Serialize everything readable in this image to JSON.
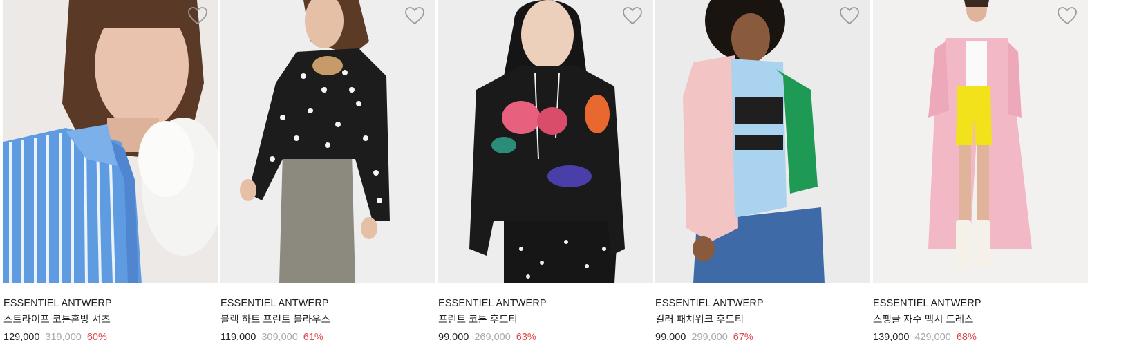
{
  "products": [
    {
      "brand": "ESSENTIEL ANTWERP",
      "name": "스트라이프 코튼혼방 셔츠",
      "price": "129,000",
      "original_price": "319,000",
      "discount": "60%",
      "image_icon": "model-striped-shirt-image",
      "colors": {
        "bg": "#ece9e7",
        "garment": "#5f9be0",
        "accent": "#f4f4f2",
        "hair": "#5a3a26",
        "skin": "#e9c3ae"
      }
    },
    {
      "brand": "ESSENTIEL ANTWERP",
      "name": "블랙 하트 프린트 블라우스",
      "price": "119,000",
      "original_price": "309,000",
      "discount": "61%",
      "image_icon": "model-heart-blouse-image",
      "colors": {
        "bg": "#eeeeee",
        "garment": "#1c1c1c",
        "accent": "#8c8a7e",
        "hair": "#5b3a26",
        "skin": "#e5bfa6"
      }
    },
    {
      "brand": "ESSENTIEL ANTWERP",
      "name": "프린트 코튼 후드티",
      "price": "99,000",
      "original_price": "269,000",
      "discount": "63%",
      "image_icon": "model-print-hoodie-image",
      "colors": {
        "bg": "#ededed",
        "garment": "#1a1a1a",
        "accent": "#e7617f",
        "hair": "#151515",
        "skin": "#ecd0bc"
      }
    },
    {
      "brand": "ESSENTIEL ANTWERP",
      "name": "컬러 패치워크 후드티",
      "price": "99,000",
      "original_price": "299,000",
      "discount": "67%",
      "image_icon": "model-patchwork-hoodie-image",
      "colors": {
        "bg": "#ebebeb",
        "garment": "#a9d3ee",
        "accent": "#f3c4c4",
        "hair": "#1a1410",
        "skin": "#8a5a3c"
      }
    },
    {
      "brand": "ESSENTIEL ANTWERP",
      "name": "스팽글 자수 맥시 드레스",
      "price": "139,000",
      "original_price": "429,000",
      "discount": "68%",
      "image_icon": "model-maxi-dress-image",
      "colors": {
        "bg": "#f2f1ef",
        "garment": "#f2b8c6",
        "accent": "#f2e21c",
        "hair": "#3a2a20",
        "skin": "#e0b49a"
      }
    }
  ],
  "wishlist_icon": "heart-outline-icon"
}
